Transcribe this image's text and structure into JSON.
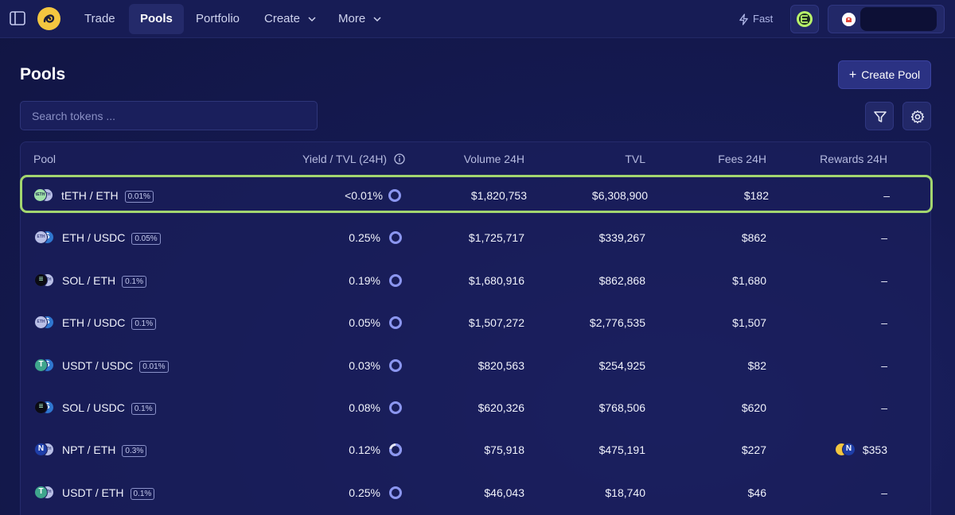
{
  "nav": {
    "items": [
      {
        "label": "Trade",
        "active": false
      },
      {
        "label": "Pools",
        "active": true
      },
      {
        "label": "Portfolio",
        "active": false
      },
      {
        "label": "Create",
        "active": false,
        "dropdown": true
      },
      {
        "label": "More",
        "active": false,
        "dropdown": true
      }
    ],
    "fast_label": "Fast",
    "icons": {
      "sidebar": "sidebar-toggle-icon",
      "logo": "app-logo",
      "fast": "lightning-icon",
      "network": "eclipse-network-icon",
      "wallet": "wallet-icon"
    }
  },
  "page": {
    "title": "Pools",
    "create_pool_label": "Create Pool",
    "search_placeholder": "Search tokens ..."
  },
  "table": {
    "headers": {
      "pool": "Pool",
      "yield": "Yield / TVL (24H)",
      "volume": "Volume 24H",
      "tvl": "TVL",
      "fees": "Fees 24H",
      "rewards": "Rewards 24H"
    },
    "rows": [
      {
        "pair": "tETH / ETH",
        "fee_tier": "0.01%",
        "yield": "<0.01%",
        "volume": "$1,820,753",
        "tvl": "$6,308,900",
        "fees": "$182",
        "rewards": "–",
        "ring": "full",
        "highlighted": true,
        "tokens": [
          {
            "symbol": "tETH",
            "color": "#9fe0a8",
            "fg": "#1b2a4e"
          },
          {
            "symbol": "ETH",
            "color": "#b9bfe6",
            "fg": "#3b4280"
          }
        ]
      },
      {
        "pair": "ETH / USDC",
        "fee_tier": "0.05%",
        "yield": "0.25%",
        "volume": "$1,725,717",
        "tvl": "$339,267",
        "fees": "$862",
        "rewards": "–",
        "ring": "full",
        "highlighted": false,
        "tokens": [
          {
            "symbol": "ETH",
            "color": "#b9bfe6",
            "fg": "#3b4280"
          },
          {
            "symbol": "$",
            "color": "#2f77d0",
            "fg": "#ffffff"
          }
        ]
      },
      {
        "pair": "SOL / ETH",
        "fee_tier": "0.1%",
        "yield": "0.19%",
        "volume": "$1,680,916",
        "tvl": "$862,868",
        "fees": "$1,680",
        "rewards": "–",
        "ring": "full",
        "highlighted": false,
        "tokens": [
          {
            "symbol": "≡",
            "color": "#0b0b14",
            "fg": "#b8ffd8"
          },
          {
            "symbol": "ETH",
            "color": "#b9bfe6",
            "fg": "#3b4280"
          }
        ]
      },
      {
        "pair": "ETH / USDC",
        "fee_tier": "0.1%",
        "yield": "0.05%",
        "volume": "$1,507,272",
        "tvl": "$2,776,535",
        "fees": "$1,507",
        "rewards": "–",
        "ring": "full",
        "highlighted": false,
        "tokens": [
          {
            "symbol": "ETH",
            "color": "#b9bfe6",
            "fg": "#3b4280"
          },
          {
            "symbol": "$",
            "color": "#2f77d0",
            "fg": "#ffffff"
          }
        ]
      },
      {
        "pair": "USDT / USDC",
        "fee_tier": "0.01%",
        "yield": "0.03%",
        "volume": "$820,563",
        "tvl": "$254,925",
        "fees": "$82",
        "rewards": "–",
        "ring": "full",
        "highlighted": false,
        "tokens": [
          {
            "symbol": "T",
            "color": "#3fa68c",
            "fg": "#ffffff"
          },
          {
            "symbol": "$",
            "color": "#2f77d0",
            "fg": "#ffffff"
          }
        ]
      },
      {
        "pair": "SOL / USDC",
        "fee_tier": "0.1%",
        "yield": "0.08%",
        "volume": "$620,326",
        "tvl": "$768,506",
        "fees": "$620",
        "rewards": "–",
        "ring": "full",
        "highlighted": false,
        "tokens": [
          {
            "symbol": "≡",
            "color": "#0b0b14",
            "fg": "#b8ffd8"
          },
          {
            "symbol": "$",
            "color": "#2f77d0",
            "fg": "#ffffff"
          }
        ]
      },
      {
        "pair": "NPT / ETH",
        "fee_tier": "0.3%",
        "yield": "0.12%",
        "volume": "$75,918",
        "tvl": "$475,191",
        "fees": "$227",
        "rewards": "$353",
        "ring": "partial",
        "highlighted": false,
        "tokens": [
          {
            "symbol": "N",
            "color": "#1e3ea8",
            "fg": "#ffffff"
          },
          {
            "symbol": "ETH",
            "color": "#b9bfe6",
            "fg": "#3b4280"
          }
        ]
      },
      {
        "pair": "USDT / ETH",
        "fee_tier": "0.1%",
        "yield": "0.25%",
        "volume": "$46,043",
        "tvl": "$18,740",
        "fees": "$46",
        "rewards": "–",
        "ring": "full",
        "highlighted": false,
        "tokens": [
          {
            "symbol": "T",
            "color": "#3fa68c",
            "fg": "#ffffff"
          },
          {
            "symbol": "ETH",
            "color": "#b9bfe6",
            "fg": "#3b4280"
          }
        ]
      }
    ]
  },
  "colors": {
    "accent_ring": "#8b96f0",
    "highlight_border": "#a3d66f",
    "create_button": "#2b3283"
  }
}
